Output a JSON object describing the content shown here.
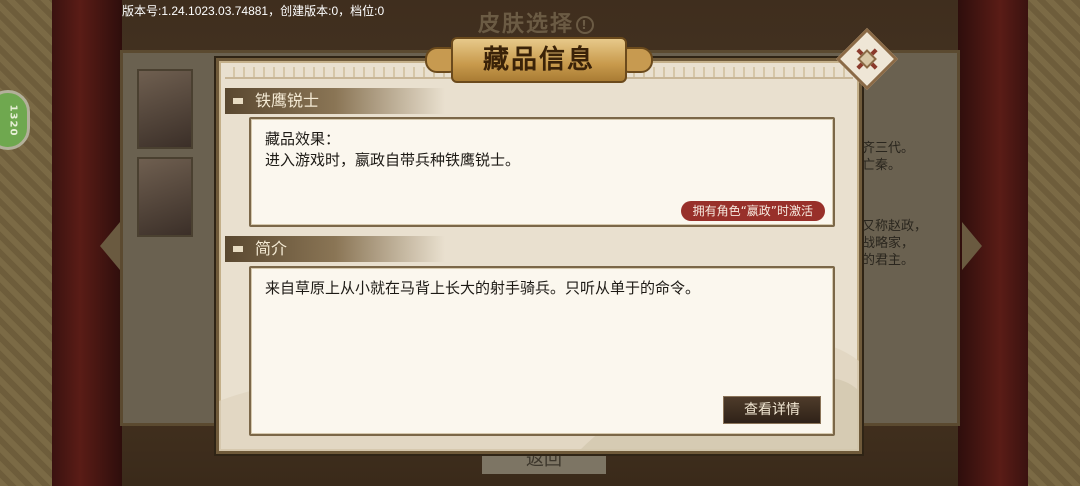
{
  "status_bar": {
    "version_text": "版本号:1.24.1023.03.74881，创建版本:0，档位:0"
  },
  "background": {
    "title": "皮肤选择",
    "side_badge": "1320",
    "side_text_top": [
      "齐三代。",
      "亡秦。"
    ],
    "side_text_bottom": [
      "又称赵政，",
      "战略家，",
      "的君主。"
    ],
    "back_label": "返回"
  },
  "dialog": {
    "title": "藏品信息",
    "item_name": "铁鹰锐士",
    "effect": {
      "label": "藏品效果：",
      "text": "进入游戏时，嬴政自带兵种铁鹰锐士。",
      "activation": "拥有角色“嬴政”时激活"
    },
    "intro": {
      "header": "简介",
      "text": "来自草原上从小就在马背上长大的射手骑兵。只听从单于的命令。"
    },
    "details_button": "查看详情"
  },
  "colors": {
    "accent_red": "#98302a",
    "panel_bg": "#e9e0cf",
    "header_brown": "#5a4830"
  },
  "icons": [
    "close-icon"
  ]
}
